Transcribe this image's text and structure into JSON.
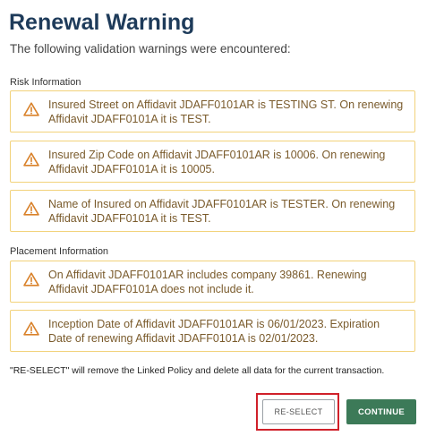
{
  "dialog": {
    "title": "Renewal Warning",
    "subtitle": "The following validation warnings were encountered:"
  },
  "sections": [
    {
      "label": "Risk Information",
      "warnings": [
        "Insured Street on Affidavit JDAFF0101AR is TESTING ST. On renewing Affidavit JDAFF0101A it is TEST.",
        "Insured Zip Code on Affidavit JDAFF0101AR is 10006. On renewing Affidavit JDAFF0101A it is 10005.",
        "Name of Insured on Affidavit JDAFF0101AR is TESTER. On renewing Affidavit JDAFF0101A it is TEST."
      ]
    },
    {
      "label": "Placement Information",
      "warnings": [
        "On Affidavit JDAFF0101AR includes company 39861. Renewing Affidavit JDAFF0101A does not include it.",
        "Inception Date of Affidavit JDAFF0101AR is 06/01/2023. Expiration Date of renewing Affidavit JDAFF0101A is 02/01/2023."
      ]
    }
  ],
  "footnote": "\"RE-SELECT\" will remove the Linked Policy and delete all data for the current transaction.",
  "buttons": {
    "reselect": "RE-SELECT",
    "continue": "CONTINUE"
  },
  "icons": {
    "warning": "warning-triangle-icon"
  },
  "colors": {
    "title": "#1e3b5a",
    "warning_border": "#f2d27a",
    "warning_icon": "#d9822b",
    "warning_text": "#7a5b2c",
    "continue_bg": "#3c7a58",
    "highlight": "#d0202a"
  }
}
